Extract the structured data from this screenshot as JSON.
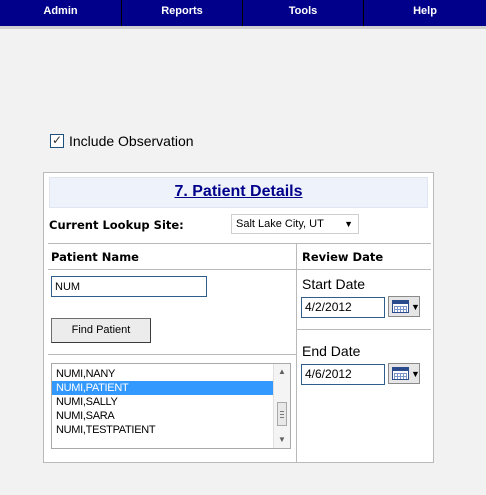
{
  "menu": [
    {
      "label": "Admin"
    },
    {
      "label": "Reports"
    },
    {
      "label": "Tools"
    },
    {
      "label": "Help"
    }
  ],
  "include_observation": {
    "label": "Include Observation",
    "checked": true
  },
  "panel": {
    "title": "7. Patient Details",
    "site_label": "Current Lookup Site:",
    "site_value": "Salt Lake City, UT",
    "patient_name_header": "Patient Name",
    "patient_name_value": "NUM",
    "find_button": "Find Patient",
    "patients": [
      {
        "name": "NUMI,NANY",
        "selected": false
      },
      {
        "name": "NUMI,PATIENT",
        "selected": true
      },
      {
        "name": "NUMI,SALLY",
        "selected": false
      },
      {
        "name": "NUMI,SARA",
        "selected": false
      },
      {
        "name": "NUMI,TESTPATIENT",
        "selected": false
      }
    ],
    "review_date_header": "Review Date",
    "start_date_label": "Start Date",
    "start_date_value": "4/2/2012",
    "end_date_label": "End Date",
    "end_date_value": "4/6/2012"
  },
  "icons": {
    "checkbox": "check-icon",
    "select_arrow": "triangle-down-icon",
    "calendar": "calendar-icon",
    "scroll_up": "triangle-up-icon",
    "scroll_down": "triangle-down-icon"
  },
  "colors": {
    "menubar": "#00008b",
    "title": "#00008b",
    "selection": "#3399ff",
    "header_bg": "#eef3fb"
  }
}
